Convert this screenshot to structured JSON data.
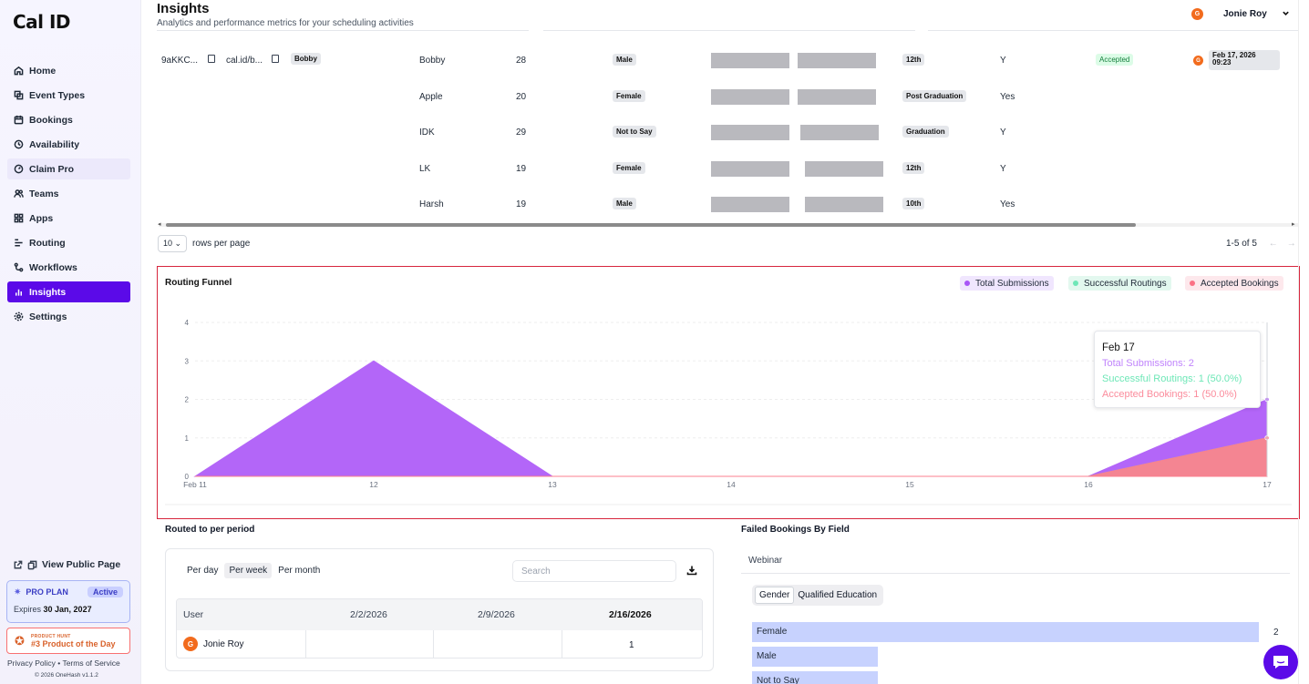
{
  "app": {
    "logo": "Cal ID"
  },
  "sidebar": {
    "items": [
      {
        "label": "Home",
        "icon": "home-icon"
      },
      {
        "label": "Event Types",
        "icon": "link-icon"
      },
      {
        "label": "Bookings",
        "icon": "calendar-icon"
      },
      {
        "label": "Availability",
        "icon": "clock-icon"
      },
      {
        "label": "Claim Pro",
        "icon": "gauge-icon"
      },
      {
        "label": "Teams",
        "icon": "users-icon"
      },
      {
        "label": "Apps",
        "icon": "grid-icon"
      },
      {
        "label": "Routing",
        "icon": "routing-icon"
      },
      {
        "label": "Workflows",
        "icon": "workflow-icon"
      },
      {
        "label": "Insights",
        "icon": "bar-chart-icon"
      },
      {
        "label": "Settings",
        "icon": "gear-icon"
      }
    ],
    "public_page": "View Public Page",
    "plan": {
      "name": "PRO PLAN",
      "badge": "Active",
      "expires_label": "Expires",
      "expires_date": "30 Jan, 2027"
    },
    "product_hunt": {
      "small": "PRODUCT HUNT",
      "big": "#3 Product of the Day"
    },
    "footer_links": "Privacy Policy • Terms of Service",
    "copyright": "© 2026 OneHash v1.1.2"
  },
  "header": {
    "title": "Insights",
    "subtitle": "Analytics and performance metrics for your scheduling activities",
    "user": {
      "name": "Jonie Roy",
      "initial": "G"
    }
  },
  "table": {
    "first_row": {
      "id": "9aKKC...",
      "link": "cal.id/b...",
      "tag": "Bobby",
      "status": "Accepted",
      "date_line1": "Feb 17, 2026",
      "date_line2": "09:23",
      "avatar_initial": "G"
    },
    "rows": [
      {
        "name": "Bobby",
        "age": "28",
        "gender": "Male",
        "education": "12th",
        "flag": "Y"
      },
      {
        "name": "Apple",
        "age": "20",
        "gender": "Female",
        "education": "Post Graduation",
        "flag": "Yes"
      },
      {
        "name": "IDK",
        "age": "29",
        "gender": "Not to Say",
        "education": "Graduation",
        "flag": "Y"
      },
      {
        "name": "LK",
        "age": "19",
        "gender": "Female",
        "education": "12th",
        "flag": "Y"
      },
      {
        "name": "Harsh",
        "age": "19",
        "gender": "Male",
        "education": "10th",
        "flag": "Yes"
      }
    ],
    "rows_per_page_value": "10",
    "rows_per_page_label": "rows per page",
    "pagination": "1-5 of 5"
  },
  "routing_funnel": {
    "title": "Routing Funnel",
    "tooltip": {
      "date": "Feb 17",
      "total": "Total Submissions: 2",
      "successful": "Successful Routings: 1 (50.0%)",
      "accepted": "Accepted Bookings: 1 (50.0%)"
    }
  },
  "chart_data": {
    "type": "area",
    "title": "Routing Funnel",
    "x": [
      "Feb 11",
      "12",
      "13",
      "14",
      "15",
      "16",
      "17"
    ],
    "y_ticks": [
      "0",
      "1",
      "2",
      "3",
      "4"
    ],
    "ylim": [
      0,
      4
    ],
    "grid": true,
    "legend_position": "top-right",
    "series": [
      {
        "name": "Total Submissions",
        "values": [
          0,
          3,
          0,
          0,
          0,
          0,
          2
        ],
        "color": "#b366f8"
      },
      {
        "name": "Successful Routings",
        "values": [
          0,
          0,
          0,
          0,
          0,
          0,
          1
        ],
        "color": "#6ee7b7"
      },
      {
        "name": "Accepted Bookings",
        "values": [
          0,
          0,
          0,
          0,
          0,
          0,
          1
        ],
        "color": "#fb7f8f"
      }
    ]
  },
  "routed_per_period": {
    "title": "Routed to per period",
    "tabs": [
      "Per day",
      "Per week",
      "Per month"
    ],
    "selected_tab": "Per week",
    "search_placeholder": "Search",
    "columns": [
      "User",
      "2/2/2026",
      "2/9/2026",
      "2/16/2026"
    ],
    "row": {
      "user": "Jonie Roy",
      "initial": "G",
      "values": [
        "",
        "",
        "1"
      ]
    }
  },
  "failed_bookings": {
    "title": "Failed Bookings By Field",
    "form": "Webinar",
    "tabs": [
      "Gender",
      "Qualified Education"
    ],
    "selected_tab": "Gender",
    "bars": [
      {
        "label": "Female",
        "value": 2,
        "count": "2"
      },
      {
        "label": "Male",
        "value": 1,
        "count": ""
      },
      {
        "label": "Not to Say",
        "value": 1,
        "count": ""
      }
    ]
  }
}
